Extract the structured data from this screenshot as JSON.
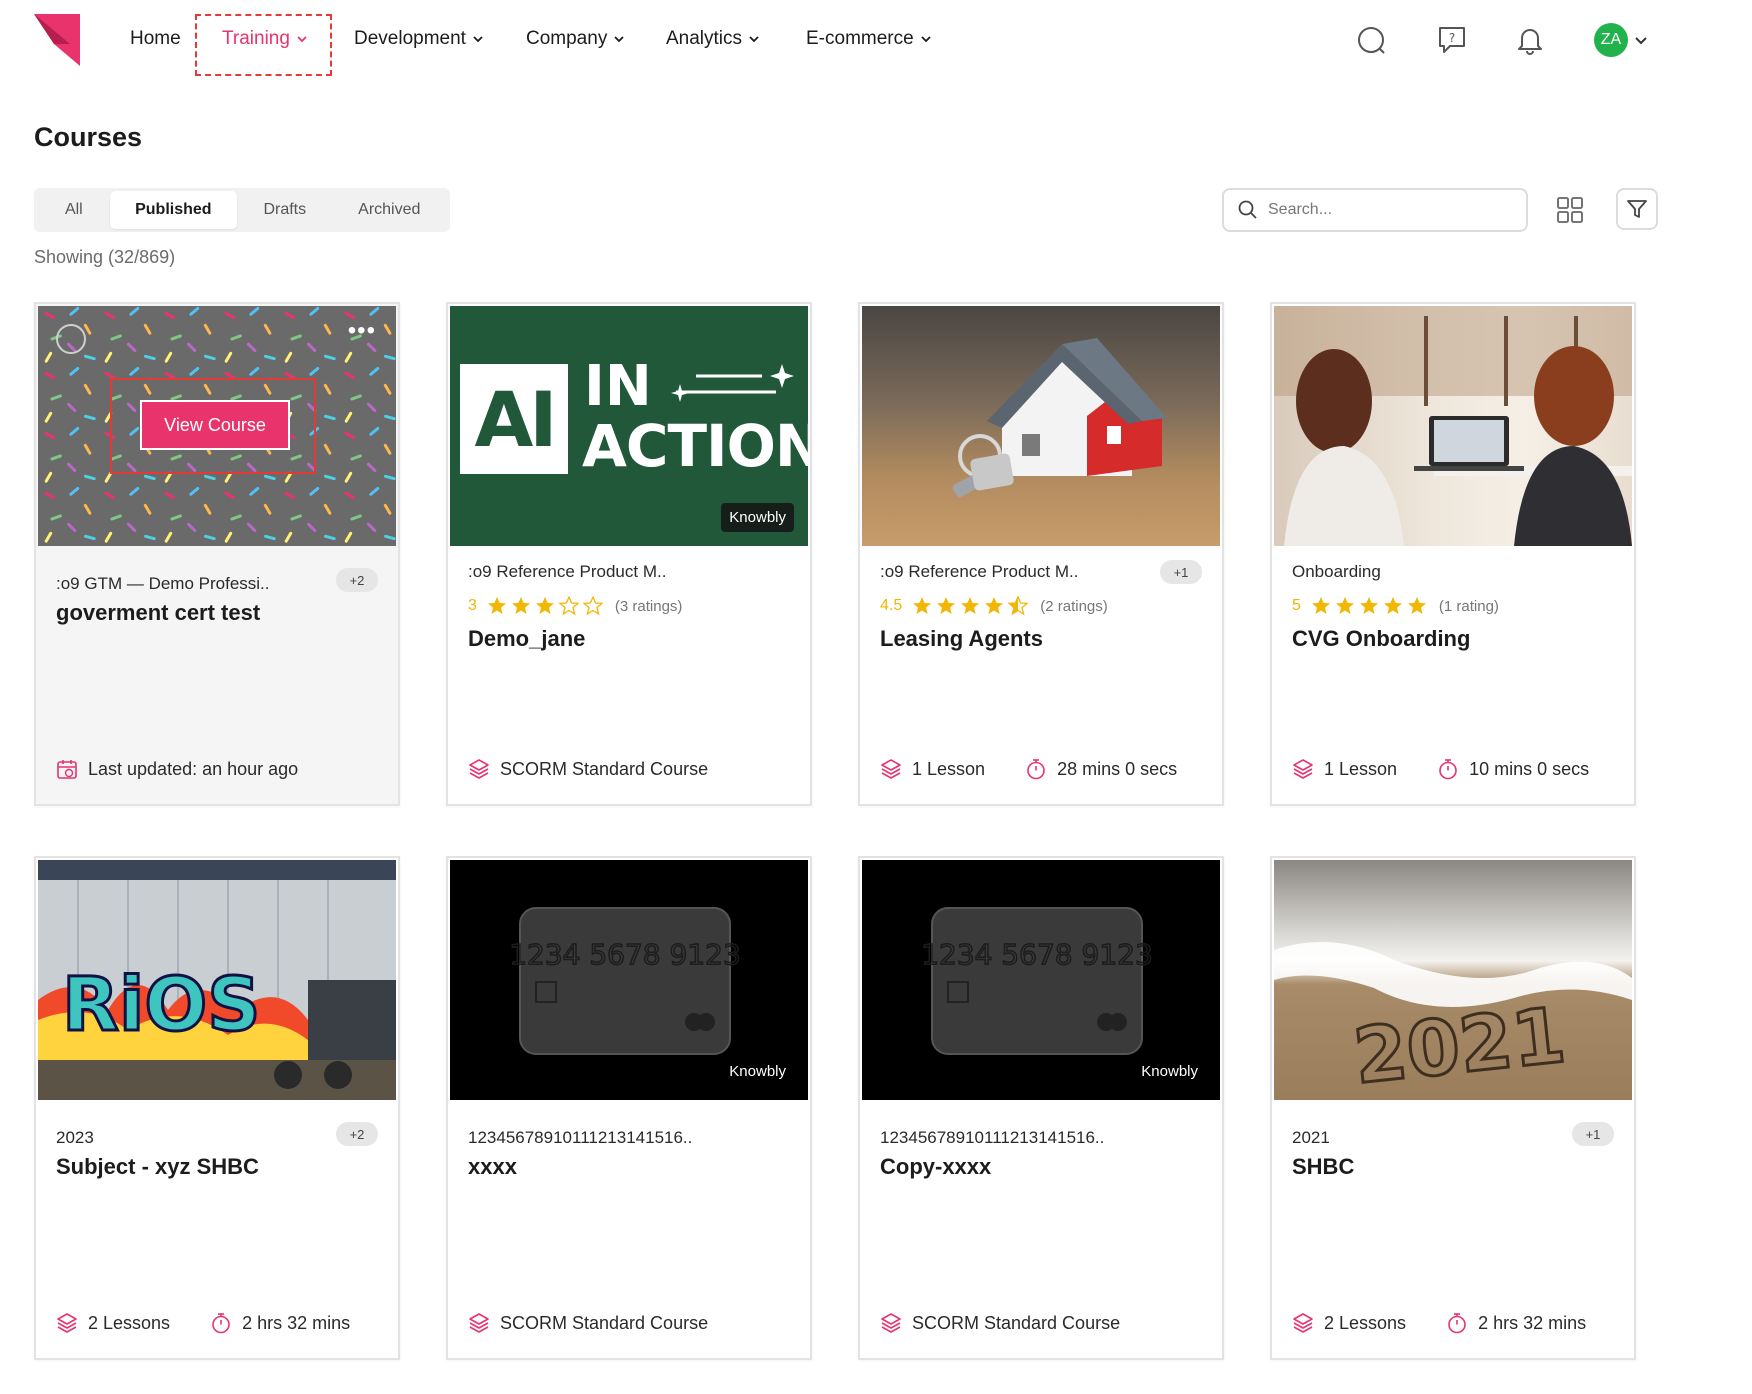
{
  "nav": {
    "home": "Home",
    "training": "Training",
    "development": "Development",
    "company": "Company",
    "analytics": "Analytics",
    "ecommerce": "E-commerce",
    "user_initials": "ZA"
  },
  "colors": {
    "accent": "#e8336d",
    "avatar": "#22b24c",
    "star": "#f2b705",
    "highlight": "#e53935"
  },
  "page": {
    "title": "Courses",
    "tabs": [
      "All",
      "Published",
      "Drafts",
      "Archived"
    ],
    "active_tab": "Published",
    "showing": "Showing (32/869)",
    "search_placeholder": "Search..."
  },
  "cards": [
    {
      "category": ":o9 GTM — Demo Professi..",
      "extra": "+2",
      "title": "goverment cert test",
      "meta1": "Last updated: an hour ago",
      "view_button": "View Course"
    },
    {
      "category": ":o9 Reference Product M..",
      "rating": "3",
      "rating_value": 3,
      "rating_count": "(3 ratings)",
      "title": "Demo_jane",
      "meta1": "SCORM Standard Course",
      "thumb_line1": "AI",
      "thumb_line2": "IN",
      "thumb_line3": "ACTION",
      "badge": "Knowbly"
    },
    {
      "category": ":o9 Reference Product M..",
      "extra": "+1",
      "rating": "4.5",
      "rating_value": 4.5,
      "rating_count": "(2 ratings)",
      "title": "Leasing Agents",
      "meta1": "1 Lesson",
      "meta2": "28 mins 0 secs"
    },
    {
      "category": "Onboarding",
      "rating": "5",
      "rating_value": 5,
      "rating_count": "(1 rating)",
      "title": "CVG Onboarding",
      "meta1": "1 Lesson",
      "meta2": "10 mins 0 secs"
    },
    {
      "category": "2023",
      "extra": "+2",
      "title": "Subject - xyz SHBC",
      "meta1": "2 Lessons",
      "meta2": "2 hrs 32 mins"
    },
    {
      "category": "12345678910111213141516..",
      "title": "xxxx",
      "meta1": "SCORM Standard Course",
      "card_number": "1234 5678 9123",
      "badge": "Knowbly"
    },
    {
      "category": "12345678910111213141516..",
      "title": "Copy-xxxx",
      "meta1": "SCORM Standard Course",
      "card_number": "1234 5678 9123",
      "badge": "Knowbly"
    },
    {
      "category": "2021",
      "extra": "+1",
      "title": "SHBC",
      "meta1": "2 Lessons",
      "meta2": "2 hrs 32 mins",
      "sand_text": "2021"
    }
  ]
}
